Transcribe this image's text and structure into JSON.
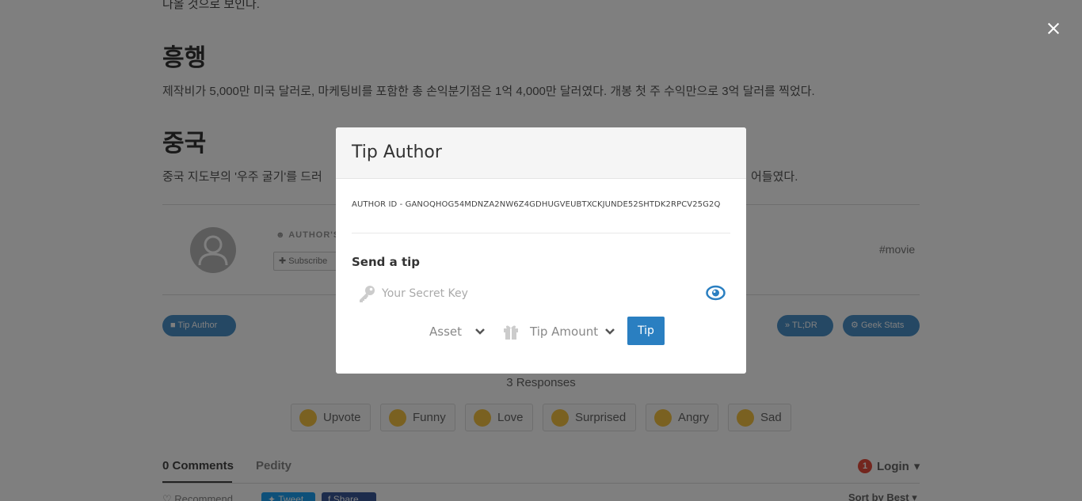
{
  "article": {
    "intro_line": "나올 것으로 보인다.",
    "section1_heading": "흥행",
    "section1_text": "제작비가 5,000만 미국 달러로, 마케팅비를 포함한 총 손익분기점은 1억 4,000만 달러였다. 개봉 첫 주 수익만으로 3억 달러를 찍었다.",
    "section2_heading": "중국",
    "section2_text_left": "중국 지도부의 '우주 굴기'를 드러",
    "section2_text_right": "어들였다."
  },
  "author_box": {
    "label": "AUTHOR'S",
    "subscribe_label": "Subscribe",
    "tag": "movie"
  },
  "action_pills": {
    "tip_author": "Tip Author",
    "tldr": "TL;DR",
    "geek_stats": "Geek Stats"
  },
  "responses": {
    "count_label": "3 Responses",
    "reactions": [
      "Upvote",
      "Funny",
      "Love",
      "Surprised",
      "Angry",
      "Sad"
    ]
  },
  "comments": {
    "tab_comments": "0 Comments",
    "tab_pedity": "Pedity",
    "login_label": "Login",
    "login_badge": "1",
    "recommend_label": "Recommend",
    "tweet_label": "Tweet",
    "share_label": "Share",
    "sort_label": "Sort by Best"
  },
  "modal": {
    "title": "Tip Author",
    "author_id": "AUTHOR ID - GANOQHOG54MDNZA2NW6Z4GDHUGVEUBTXCKJUNDE52SHTDK2RPCV25G2Q",
    "send_tip_title": "Send a tip",
    "secret_key_placeholder": "Your Secret Key",
    "asset_label": "Asset",
    "tip_amount_label": "Tip Amount",
    "tip_button": "Tip"
  },
  "colors": {
    "accent": "#2a7fc1",
    "eye_icon": "#2a7fc1",
    "overlay": "rgba(0,0,0,0.5)"
  }
}
